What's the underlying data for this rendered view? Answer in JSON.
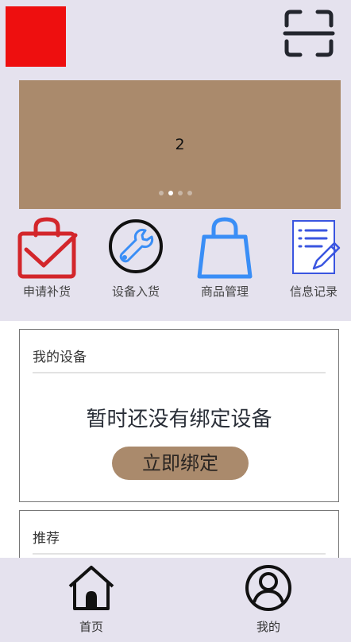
{
  "banner": {
    "slide_number": "2",
    "slide_count": 4,
    "active_index": 1
  },
  "quick_actions": [
    {
      "label": "申请补货",
      "icon": "bag-check-icon"
    },
    {
      "label": "设备入货",
      "icon": "wrench-icon"
    },
    {
      "label": "商品管理",
      "icon": "shopping-bag-icon"
    },
    {
      "label": "信息记录",
      "icon": "notepad-icon"
    }
  ],
  "device_card": {
    "title": "我的设备",
    "empty_message": "暂时还没有绑定设备",
    "bind_button": "立即绑定"
  },
  "recommend_card": {
    "title": "推荐"
  },
  "tabbar": [
    {
      "label": "首页",
      "icon": "home-icon"
    },
    {
      "label": "我的",
      "icon": "user-icon"
    }
  ],
  "colors": {
    "background": "#e5e2ee",
    "logo": "#ee0f0f",
    "accent_brown": "#aa8a6c",
    "icon_red": "#d3262b",
    "icon_blue": "#3a8ef6"
  }
}
